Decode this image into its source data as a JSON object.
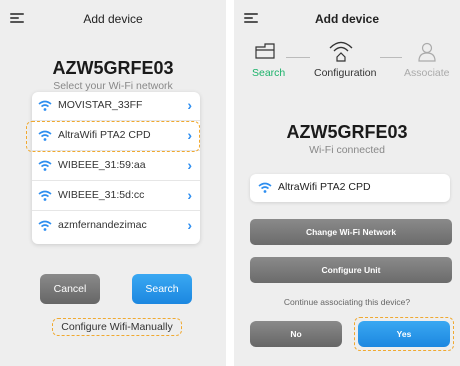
{
  "left": {
    "title": "Add device",
    "device_name": "AZW5GRFE03",
    "subtitle": "Select your Wi-Fi network",
    "networks": [
      {
        "name": "MOVISTAR_33FF"
      },
      {
        "name": "AltraWifi PTA2 CPD"
      },
      {
        "name": "WIBEEE_31:59:aa"
      },
      {
        "name": "WIBEEE_31:5d:cc"
      },
      {
        "name": "azmfernandezimac"
      }
    ],
    "cancel_label": "Cancel",
    "search_label": "Search",
    "manual_label": "Configure Wifi-Manually"
  },
  "right": {
    "title": "Add device",
    "steps": [
      {
        "label": "Search",
        "color": "#1db36b"
      },
      {
        "label": "Configuration",
        "color": "#333333"
      },
      {
        "label": "Associate",
        "color": "#aaaaaa"
      }
    ],
    "device_name": "AZW5GRFE03",
    "status": "Wi-Fi connected",
    "network": "AltraWifi PTA2 CPD",
    "change_wifi_label": "Change Wi-Fi Network",
    "configure_unit_label": "Configure Unit",
    "question": "Continue associating this device?",
    "no_label": "No",
    "yes_label": "Yes"
  },
  "colors": {
    "accent": "#2d8ef0",
    "highlight": "#f0a930",
    "step_done": "#1db36b"
  }
}
